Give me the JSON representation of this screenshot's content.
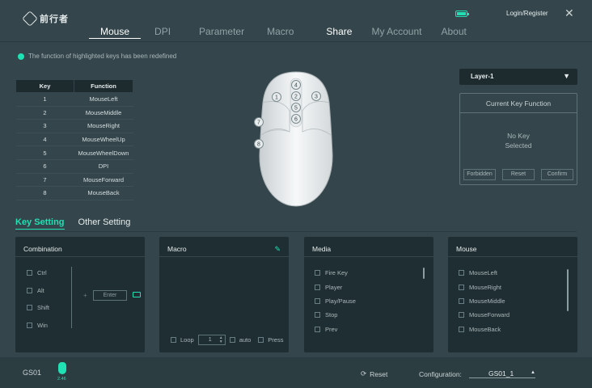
{
  "app": {
    "logo_text": "前行者"
  },
  "nav": {
    "items": [
      "Mouse",
      "DPI",
      "Parameter",
      "Macro",
      "Share",
      "My Account",
      "About"
    ]
  },
  "header": {
    "login": "Login/Register",
    "close": "✕",
    "accent": "#21e0b4"
  },
  "notice": "The function of highlighted keys has been redefined",
  "key_table": {
    "headers": [
      "Key",
      "Function"
    ],
    "rows": [
      [
        "1",
        "MouseLeft"
      ],
      [
        "2",
        "MouseMiddle"
      ],
      [
        "3",
        "MouseRight"
      ],
      [
        "4",
        "MouseWheelUp"
      ],
      [
        "5",
        "MouseWheelDown"
      ],
      [
        "6",
        "DPI"
      ],
      [
        "7",
        "MouseForward"
      ],
      [
        "8",
        "MouseBack"
      ]
    ]
  },
  "mouse_markers": [
    "1",
    "2",
    "3",
    "4",
    "5",
    "6",
    "7",
    "8"
  ],
  "layer": {
    "selected": "Layer-1",
    "caret": "▼"
  },
  "current_key": {
    "title": "Current Key Function",
    "line1": "No Key",
    "line2": "Selected",
    "buttons": [
      "Forbidden",
      "Reset",
      "Confirm"
    ]
  },
  "setting_tabs": [
    "Key Setting",
    "Other Setting"
  ],
  "combination": {
    "title": "Combination",
    "modifiers": [
      "Ctrl",
      "Alt",
      "Shift",
      "Win"
    ],
    "plus": "+",
    "enter_label": "Enter"
  },
  "macro": {
    "title": "Macro",
    "loop": "Loop",
    "count": "1",
    "auto": "auto",
    "press": "Press"
  },
  "media": {
    "title": "Media",
    "items": [
      "Fire Key",
      "Player",
      "Play/Pause",
      "Stop",
      "Prev"
    ]
  },
  "mouse_panel": {
    "title": "Mouse",
    "items": [
      "MouseLeft",
      "MouseRight",
      "MouseMiddle",
      "MouseForward",
      "MouseBack"
    ]
  },
  "footer": {
    "device": "GS01",
    "version": "2.46",
    "reset": "Reset",
    "config_label": "Configuration:",
    "config_value": "GS01_1",
    "caret": "▲"
  }
}
